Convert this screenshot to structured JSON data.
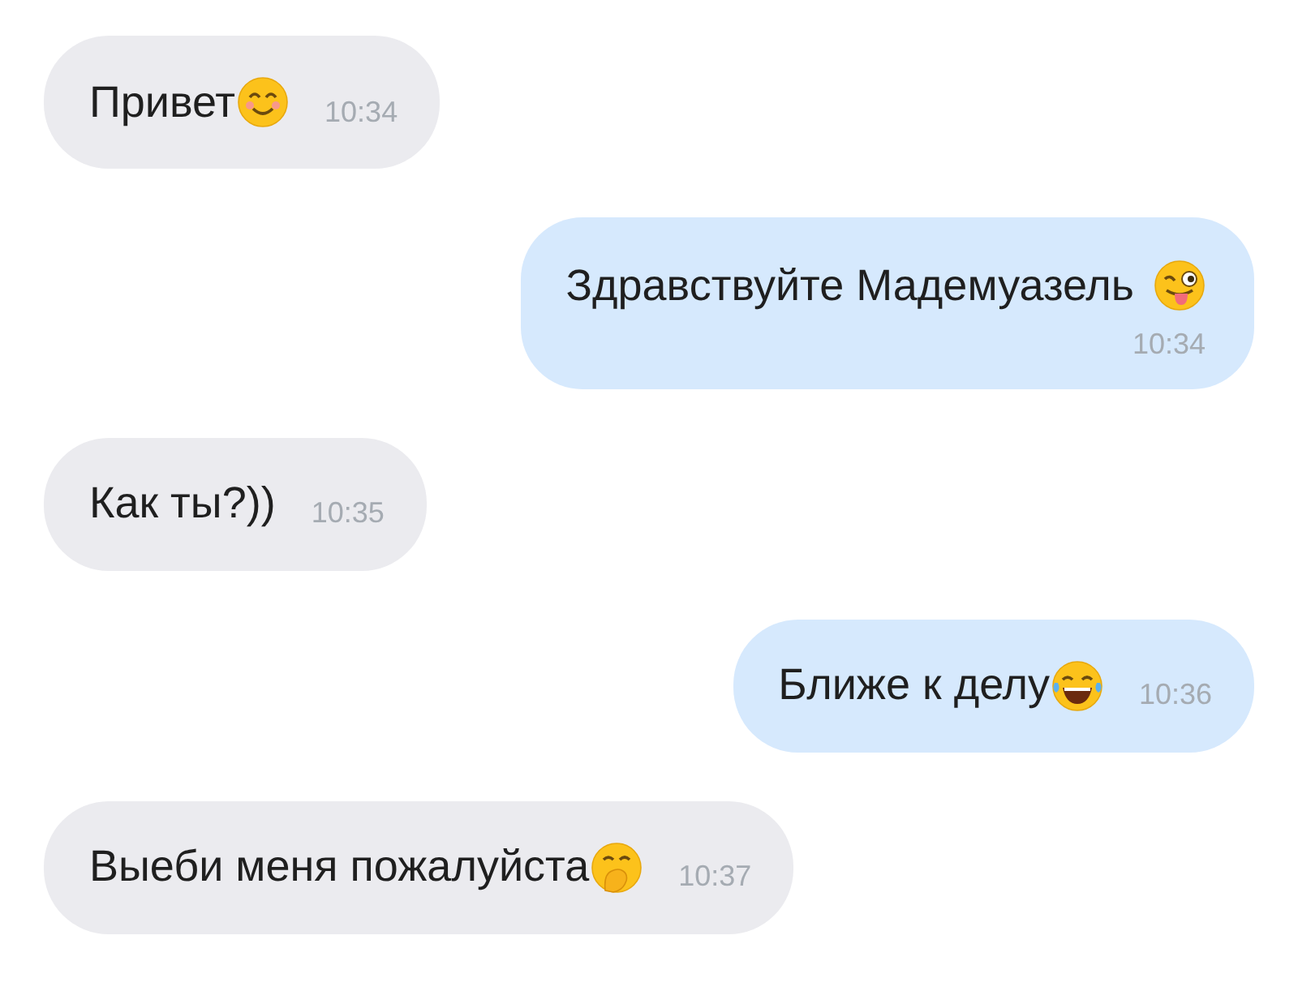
{
  "messages": [
    {
      "outgoing": false,
      "text": "Привет",
      "kind": "smile",
      "time": "10:34",
      "time_below": false
    },
    {
      "outgoing": true,
      "text": "Здравствуйте Мадемуазель",
      "kind": "wink",
      "time": "10:34",
      "time_below": true
    },
    {
      "outgoing": false,
      "text": "Как ты?))",
      "kind": "plain",
      "time": "10:35",
      "time_below": false
    },
    {
      "outgoing": true,
      "text": "Ближе к делу",
      "kind": "laugh",
      "time": "10:36",
      "time_below": false
    },
    {
      "outgoing": false,
      "text": "Выеби меня пожалуйста",
      "kind": "giggle",
      "time": "10:37",
      "time_below": false
    }
  ]
}
